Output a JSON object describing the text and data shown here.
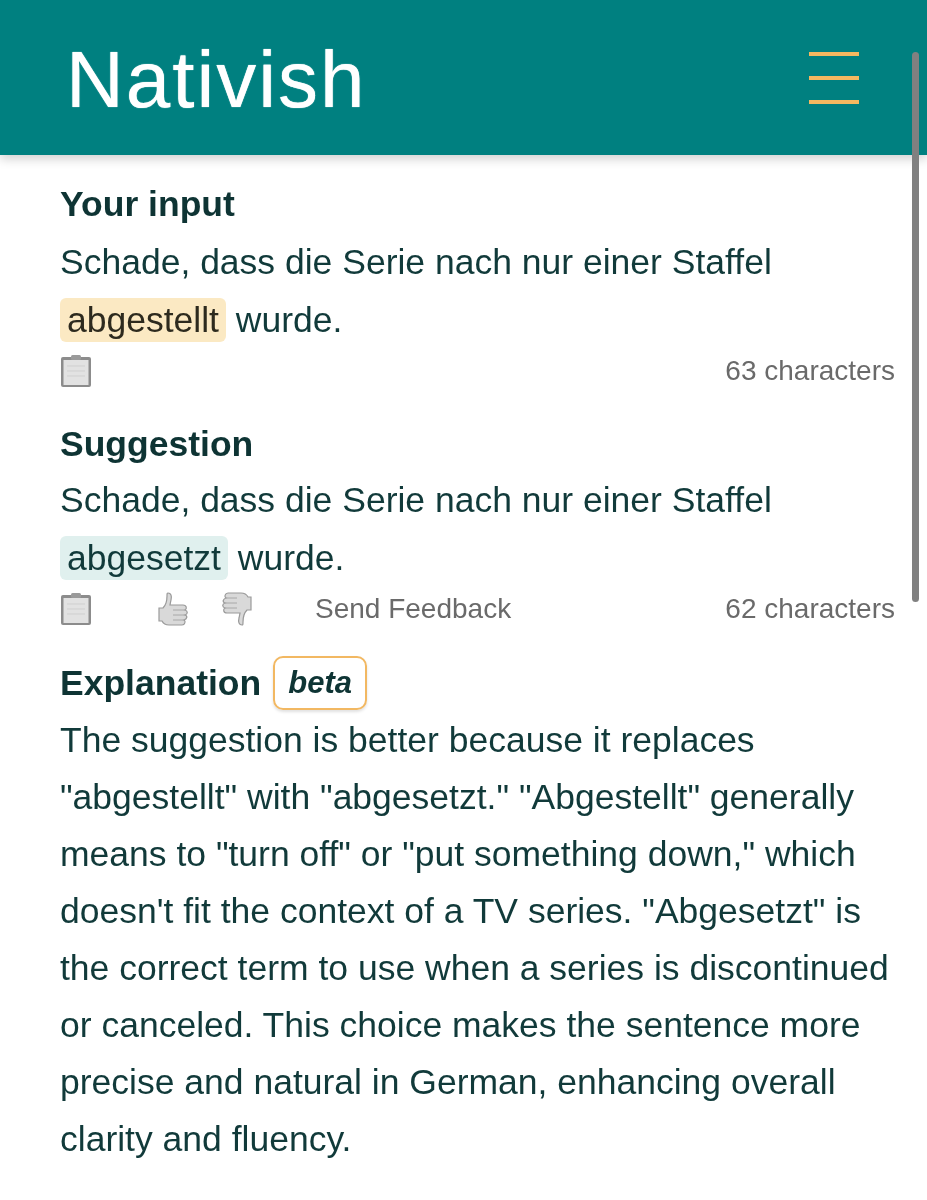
{
  "header": {
    "logo": "Nativish"
  },
  "input": {
    "title": "Your input",
    "text_before": "Schade, dass die Serie nach nur einer Staffel",
    "highlight": "abgestellt",
    "text_after": "wurde.",
    "char_count": "63 characters"
  },
  "suggestion": {
    "title": "Suggestion",
    "text_before": "Schade, dass die Serie nach nur einer Staffel",
    "highlight": "abgesetzt",
    "text_after": "wurde.",
    "feedback_label": "Send Feedback",
    "char_count": "62 characters"
  },
  "explanation": {
    "title": "Explanation",
    "badge": "beta",
    "text": "The suggestion is better because it replaces \"abgestellt\" with \"abgesetzt.\" \"Abgestellt\" generally means to \"turn off\" or \"put something down,\" which doesn't fit the context of a TV series. \"Abgesetzt\" is the correct term to use when a series is discontinued or canceled. This choice makes the sentence more precise and natural in German, enhancing overall clarity and fluency."
  }
}
